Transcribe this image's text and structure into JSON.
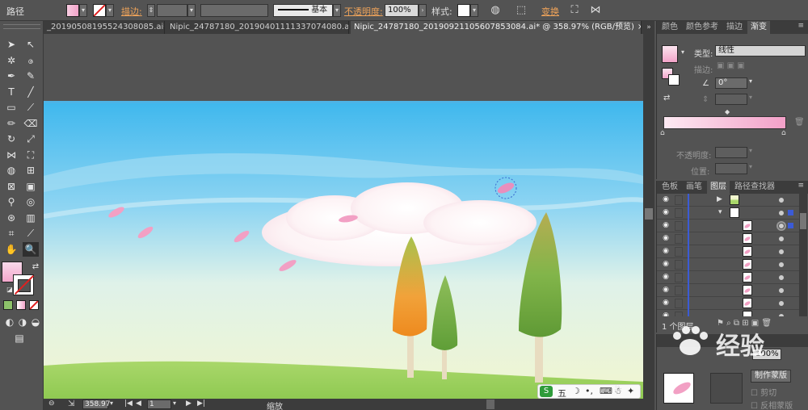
{
  "control_bar": {
    "object_type": "路径",
    "stroke_label": "描边:",
    "stroke_style": "基本",
    "opacity_label": "不透明度:",
    "opacity_value": "100%",
    "style_label": "样式:",
    "transform_label": "变换"
  },
  "tabs": [
    {
      "label": "_20190508195524308085.ai*",
      "close": "×"
    },
    {
      "label": "Nipic_24787180_20190401111337074080.ai*",
      "close": "×"
    },
    {
      "label": "Nipic_24787180_20190921105607853084.ai* @ 358.97% (RGB/预览)",
      "close": "×",
      "active": true
    }
  ],
  "tabs_scroll": "»",
  "tools": [
    {
      "name": "selection-tool-icon",
      "glyph": "➤"
    },
    {
      "name": "direct-selection-tool-icon",
      "glyph": "↖"
    },
    {
      "name": "magic-wand-tool-icon",
      "glyph": "✲"
    },
    {
      "name": "lasso-tool-icon",
      "glyph": "ဇ"
    },
    {
      "name": "pen-tool-icon",
      "glyph": "✒"
    },
    {
      "name": "curvature-tool-icon",
      "glyph": "✎"
    },
    {
      "name": "type-tool-icon",
      "glyph": "T"
    },
    {
      "name": "line-tool-icon",
      "glyph": "╱"
    },
    {
      "name": "rectangle-tool-icon",
      "glyph": "▭"
    },
    {
      "name": "paintbrush-tool-icon",
      "glyph": "⟋"
    },
    {
      "name": "pencil-tool-icon",
      "glyph": "✏"
    },
    {
      "name": "eraser-tool-icon",
      "glyph": "⌫"
    },
    {
      "name": "rotate-tool-icon",
      "glyph": "↻"
    },
    {
      "name": "scale-tool-icon",
      "glyph": "⤢"
    },
    {
      "name": "width-tool-icon",
      "glyph": "⋈"
    },
    {
      "name": "free-transform-tool-icon",
      "glyph": "⛶"
    },
    {
      "name": "shape-builder-tool-icon",
      "glyph": "◍"
    },
    {
      "name": "perspective-grid-tool-icon",
      "glyph": "⊞"
    },
    {
      "name": "mesh-tool-icon",
      "glyph": "⊠"
    },
    {
      "name": "gradient-tool-icon",
      "glyph": "▣"
    },
    {
      "name": "eyedropper-tool-icon",
      "glyph": "⚲"
    },
    {
      "name": "blend-tool-icon",
      "glyph": "◎"
    },
    {
      "name": "symbol-sprayer-tool-icon",
      "glyph": "⊛"
    },
    {
      "name": "column-graph-tool-icon",
      "glyph": "▥"
    },
    {
      "name": "artboard-tool-icon",
      "glyph": "⌗"
    },
    {
      "name": "slice-tool-icon",
      "glyph": "⟋"
    },
    {
      "name": "hand-tool-icon",
      "glyph": "✋"
    },
    {
      "name": "zoom-tool-icon",
      "glyph": "🔍"
    }
  ],
  "status": {
    "zoom": "358.97",
    "artboard": "1",
    "tool": "缩放"
  },
  "color_panel": {
    "tabs": [
      "颜色",
      "颜色参考",
      "描边",
      "渐变"
    ],
    "type_label": "类型:",
    "type_value": "线性",
    "stroke_label": "描边:",
    "angle_value": "0°",
    "opacity_label": "不透明度:",
    "position_label": "位置:"
  },
  "layers_panel": {
    "tabs": [
      "色板",
      "画笔",
      "图层",
      "路径查找器"
    ],
    "footer": "1 个图层"
  },
  "transparency_panel": {
    "opacity_value": "100%",
    "make_mask": "制作蒙版",
    "clip": "剪切",
    "invert": "反相蒙版"
  },
  "ime_bar": {
    "label": "五"
  },
  "watermark": "经验"
}
